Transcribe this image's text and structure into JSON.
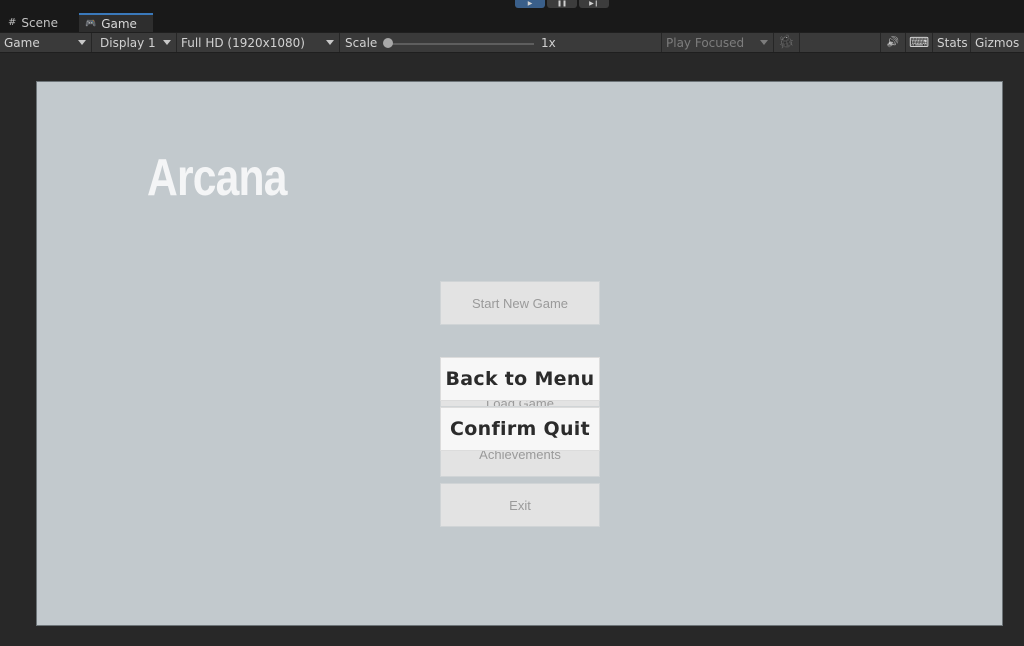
{
  "playback": {
    "play_icon": "play-icon",
    "pause_icon": "pause-icon",
    "step_icon": "step-icon",
    "play_glyph": "▶",
    "pause_glyph": "❚❚",
    "step_glyph": "▶❙"
  },
  "tabs": [
    {
      "label": "Scene",
      "icon": "grid-icon",
      "glyph": "#"
    },
    {
      "label": "Game",
      "icon": "gamepad-icon",
      "glyph": "🎮"
    }
  ],
  "toolbar": {
    "game_mode": "Game",
    "display": "Display 1",
    "resolution": "Full HD (1920x1080)",
    "scale_label": "Scale",
    "scale_value": "1x",
    "scale_fraction": 0,
    "play_focused": "Play Focused",
    "bug_icon": "bug-icon",
    "bug_glyph": "🐞",
    "audio_icon": "audio-icon",
    "audio_glyph": "🔊",
    "keyboard_icon": "keyboard-icon",
    "keyboard_glyph": "⌨",
    "stats": "Stats",
    "gizmos": "Gizmos"
  },
  "game": {
    "title": "Arcana",
    "menu": {
      "start": "Start New Game",
      "load": "Load Game",
      "achievements": "Achievements",
      "exit": "Exit"
    },
    "dialog": {
      "back": "Back to Menu",
      "confirm": "Confirm Quit"
    },
    "colors": {
      "background": "#c2c9cd",
      "menu_button": "#e3e3e3",
      "dialog_button": "#f7f7f7"
    }
  }
}
